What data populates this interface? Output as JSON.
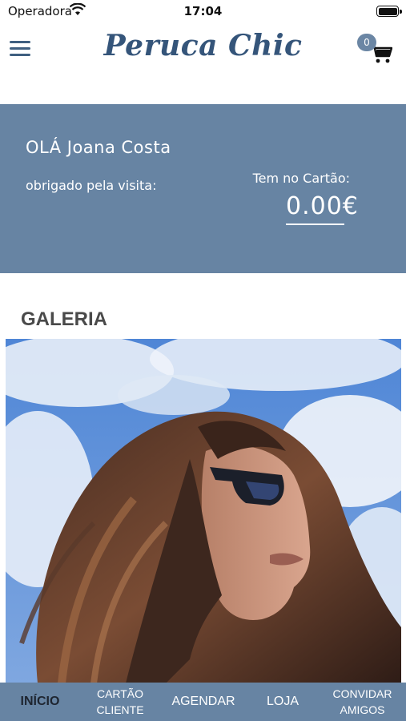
{
  "status_bar": {
    "carrier": "Operadora",
    "time": "17:04",
    "icons": [
      "wifi-icon",
      "battery-icon"
    ]
  },
  "header": {
    "logo_text": "Peruca Chic",
    "brand_color": "#35557a",
    "menu_icon": "hamburger-menu-icon",
    "cart": {
      "icon": "shopping-cart-icon",
      "count": "0"
    }
  },
  "greeting": {
    "hello": "OLÁ Joana Costa",
    "thanks": "obrigado pela visita:",
    "card_label": "Tem no Cartão:",
    "card_balance": "0.00€",
    "background_color": "#6784a3"
  },
  "gallery": {
    "title": "GALERIA"
  },
  "bottom_nav": {
    "items": [
      {
        "line1": "INÍCIO",
        "line2": ""
      },
      {
        "line1": "CARTÃO",
        "line2": "CLIENTE"
      },
      {
        "line1": "AGENDAR",
        "line2": ""
      },
      {
        "line1": "LOJA",
        "line2": ""
      },
      {
        "line1": "CONVIDAR",
        "line2": "AMIGOS"
      }
    ],
    "active_index": 0
  }
}
